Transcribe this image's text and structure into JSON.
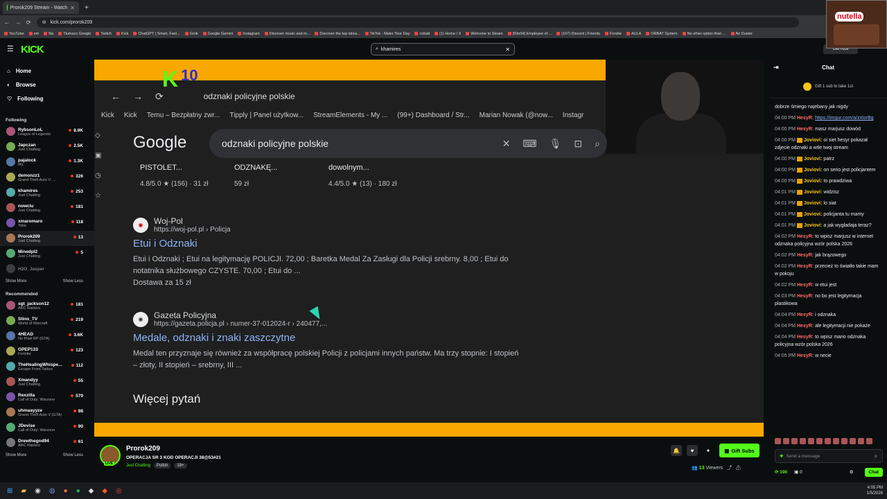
{
  "browser": {
    "tabs": [
      {
        "label": "Prorok209 Stream - Watch",
        "active": true
      }
    ],
    "url": "kick.com/prorok209",
    "bookmarks": [
      "YouTube",
      "em",
      "Na",
      "Tłumacz Google",
      "Twitch",
      "Kick",
      "ChatGPT | Smart, Fast...",
      "Grok",
      "Google Gemini",
      "Instagram",
      "Discover music and m...",
      "Discover the top strea...",
      "TikTok - Make Your Day",
      "cobalt",
      "(1) Home / X",
      "Welcome to Steam",
      "[93e04] Employee of ...",
      "(107) Discord | Friends",
      "Forsite",
      "AULA",
      "ORBAT System",
      "No other option than ...",
      "Air Duster"
    ]
  },
  "kick": {
    "logo": "KICK",
    "search_value": "khamires",
    "get_kick": "Get Kick",
    "promo_label": "nutella"
  },
  "sidebar": {
    "nav": [
      {
        "label": "Home",
        "icon": "home-icon"
      },
      {
        "label": "Browse",
        "icon": "browse-icon"
      },
      {
        "label": "Following",
        "icon": "heart-icon"
      }
    ],
    "following_title": "Following",
    "following": [
      {
        "name": "RybsonLoL",
        "game": "League of Legends",
        "viewers": "8.9K"
      },
      {
        "name": "Japczan",
        "game": "Just Chatting",
        "viewers": "2.5K"
      },
      {
        "name": "pajalock",
        "game": "IRL",
        "viewers": "1.3K"
      },
      {
        "name": "demonzz1",
        "game": "Grand Theft Auto V: ...",
        "viewers": "326"
      },
      {
        "name": "khamires",
        "game": "Just Chatting",
        "viewers": "253"
      },
      {
        "name": "nowclu",
        "game": "Just Chatting",
        "viewers": "181"
      },
      {
        "name": "xmaromaro",
        "game": "Tibia",
        "viewers": "118"
      },
      {
        "name": "Prorok209",
        "game": "Just Chatting",
        "viewers": "13",
        "selected": true
      },
      {
        "name": "Minedpl2",
        "game": "Just Chatting",
        "viewers": "5"
      },
      {
        "name": "H2O_Jasper",
        "game": "",
        "viewers": "",
        "offline": true
      }
    ],
    "show_more": "Show More",
    "show_less": "Show Less",
    "recommended_title": "Recommended",
    "recommended": [
      {
        "name": "sgt_jackson12",
        "game": "ARC Raiders",
        "viewers": "181"
      },
      {
        "name": "Stino_TV",
        "game": "World of Warcraft",
        "viewers": "219"
      },
      {
        "name": "4HEAD",
        "game": "No Pixel RP (GTA)",
        "viewers": "3.6K"
      },
      {
        "name": "GPEP133",
        "game": "Fortnite",
        "viewers": "123"
      },
      {
        "name": "TheHealingWhispe...",
        "game": "Escape From Tarkov",
        "viewers": "112"
      },
      {
        "name": "Xmandyy",
        "game": "Just Chatting",
        "viewers": "55"
      },
      {
        "name": "Rexzilla",
        "game": "Call of Duty: Warzone",
        "viewers": "579"
      },
      {
        "name": "uhmaayyze",
        "game": "Grand Theft Auto V (GTA)",
        "viewers": "98"
      },
      {
        "name": "JDevise",
        "game": "Call of Duty: Warzone",
        "viewers": "90"
      },
      {
        "name": "Drewthegod94",
        "game": "ARC Raiders",
        "viewers": "61"
      }
    ]
  },
  "video": {
    "overlay_logo": "K",
    "overlay_number": "10",
    "inner_url": "odznaki policyjne polskie",
    "inner_bookmarks": [
      "Kick",
      "Kick",
      "Temu – Bezpłatny zwr...",
      "Tipply | Panel użytkow...",
      "StreamElements - My ...",
      "(99+) Dashboard / Str...",
      "Marian Nowak (@now...",
      "Instagr"
    ],
    "google_logo": "Google",
    "google_query": "odznaki policyjne polskie",
    "shopping": [
      {
        "title": "PISTOLET...",
        "rating": "4.8/5.0 ★ (156) · 31 zł"
      },
      {
        "title": "ODZNAKĘ...",
        "rating": "59 zł"
      },
      {
        "title": "dowolnym...",
        "rating": "4.4/5.0 ★ (13) · 180 zł"
      }
    ],
    "results": [
      {
        "site": "Woj-Pol",
        "url": "https://woj-pol.pl › Policja",
        "title": "Etui i Odznaki",
        "snippet": "Etui i Odznaki ; Etui na legitymację POLICJI. 72,00 ; Baretka Medal Za Zasługi dla Policji srebrny. 8,00 ; Etui do notatnika służbowego CZYSTE. 70,00 ; Etui do ...",
        "extra": "Dostawa za 15 zł"
      },
      {
        "site": "Gazeta Policyjna",
        "url": "https://gazeta.policja.pl › numer-37-012024-r › 240477,...",
        "title": "Medale, odznaki i znaki zaszczytne",
        "snippet": "Medal ten przyznaje się również za współpracę polskiej Policji z policjami innych państw. Ma trzy stopnie: I stopień – złoty, II stopień – srebrny, III ...",
        "extra": ""
      }
    ],
    "more_questions": "Więcej pytań"
  },
  "stream": {
    "name": "Prorok209",
    "title": "OPERACJA SR 3 KOD OPERACJI 38@53#21",
    "category": "Just Chatting",
    "tags": [
      "Polish",
      "18+"
    ],
    "live": "LIVE",
    "gift_subs": "Gift Subs",
    "viewers_count": "13",
    "viewers_label": "Viewers"
  },
  "chat": {
    "title": "Chat",
    "gift_banner": "Gift 1 sub to take 1st",
    "messages": [
      {
        "time": "",
        "user": "",
        "text": "dobrze śmiego najebany jak nigdy",
        "color": "#ffffff",
        "badge": false
      },
      {
        "time": "04:00 PM",
        "user": "HesyR:",
        "text": "https://imgur.com/a/zxlorBg",
        "color": "#ff6b6b",
        "badge": false,
        "link": true
      },
      {
        "time": "04:00 PM",
        "user": "HesyR:",
        "text": "masz marjusz dowód",
        "color": "#ff6b6b",
        "badge": false
      },
      {
        "time": "04:00 PM",
        "user": "Joviovi:",
        "text": "oi siet hesyr pokazał zdjecie odznaki a wtle twoj stream",
        "color": "#f5c518",
        "badge": true
      },
      {
        "time": "04:00 PM",
        "user": "Joviovi:",
        "text": "patrz",
        "color": "#f5c518",
        "badge": true
      },
      {
        "time": "04:00 PM",
        "user": "Joviovi:",
        "text": "on serio jest policjantem",
        "color": "#f5c518",
        "badge": true
      },
      {
        "time": "04:00 PM",
        "user": "Joviovi:",
        "text": "to prawdziwa",
        "color": "#f5c518",
        "badge": true
      },
      {
        "time": "04:01 PM",
        "user": "Joviovi:",
        "text": "widzisz",
        "color": "#f5c518",
        "badge": true
      },
      {
        "time": "04:01 PM",
        "user": "Joviovi:",
        "text": "lo siat",
        "color": "#f5c518",
        "badge": true
      },
      {
        "time": "04:01 PM",
        "user": "Joviovi:",
        "text": "policjanta tu mamy",
        "color": "#f5c518",
        "badge": true
      },
      {
        "time": "04:01 PM",
        "user": "Joviovi:",
        "text": "a jak wygladaja teraz?",
        "color": "#f5c518",
        "badge": true
      },
      {
        "time": "04:02 PM",
        "user": "HesyR:",
        "text": "to wpisz marjusz w internet odznaka policyjna wzór polska 2026",
        "color": "#ff6b6b",
        "badge": false
      },
      {
        "time": "04:02 PM",
        "user": "HesyR:",
        "text": "jak brązowego",
        "color": "#ff6b6b",
        "badge": false
      },
      {
        "time": "04:02 PM",
        "user": "HesyR:",
        "text": "przecież to światło takie mam w pokoju",
        "color": "#ff6b6b",
        "badge": false
      },
      {
        "time": "04:02 PM",
        "user": "HesyR:",
        "text": "w etui jest",
        "color": "#ff6b6b",
        "badge": false
      },
      {
        "time": "04:03 PM",
        "user": "HesyR:",
        "text": "no bo jest legitymacja plastikowa",
        "color": "#ff6b6b",
        "badge": false
      },
      {
        "time": "04:04 PM",
        "user": "HesyR:",
        "text": "i odznaka",
        "color": "#ff6b6b",
        "badge": false
      },
      {
        "time": "04:04 PM",
        "user": "HesyR:",
        "text": "ale legitymacji nie pokaże",
        "color": "#ff6b6b",
        "badge": false
      },
      {
        "time": "04:04 PM",
        "user": "HesyR:",
        "text": "to wpisz mario odznaka policyjna wzór polska 2026",
        "color": "#ff6b6b",
        "badge": false
      },
      {
        "time": "04:05 PM",
        "user": "HesyR:",
        "text": "w necie",
        "color": "#ff6b6b",
        "badge": false
      }
    ],
    "send_placeholder": "Send a message",
    "points": "190",
    "counter": "0",
    "chat_button": "Chat"
  },
  "taskbar": {
    "time": "4:05 PM",
    "date": "1/5/2026"
  }
}
